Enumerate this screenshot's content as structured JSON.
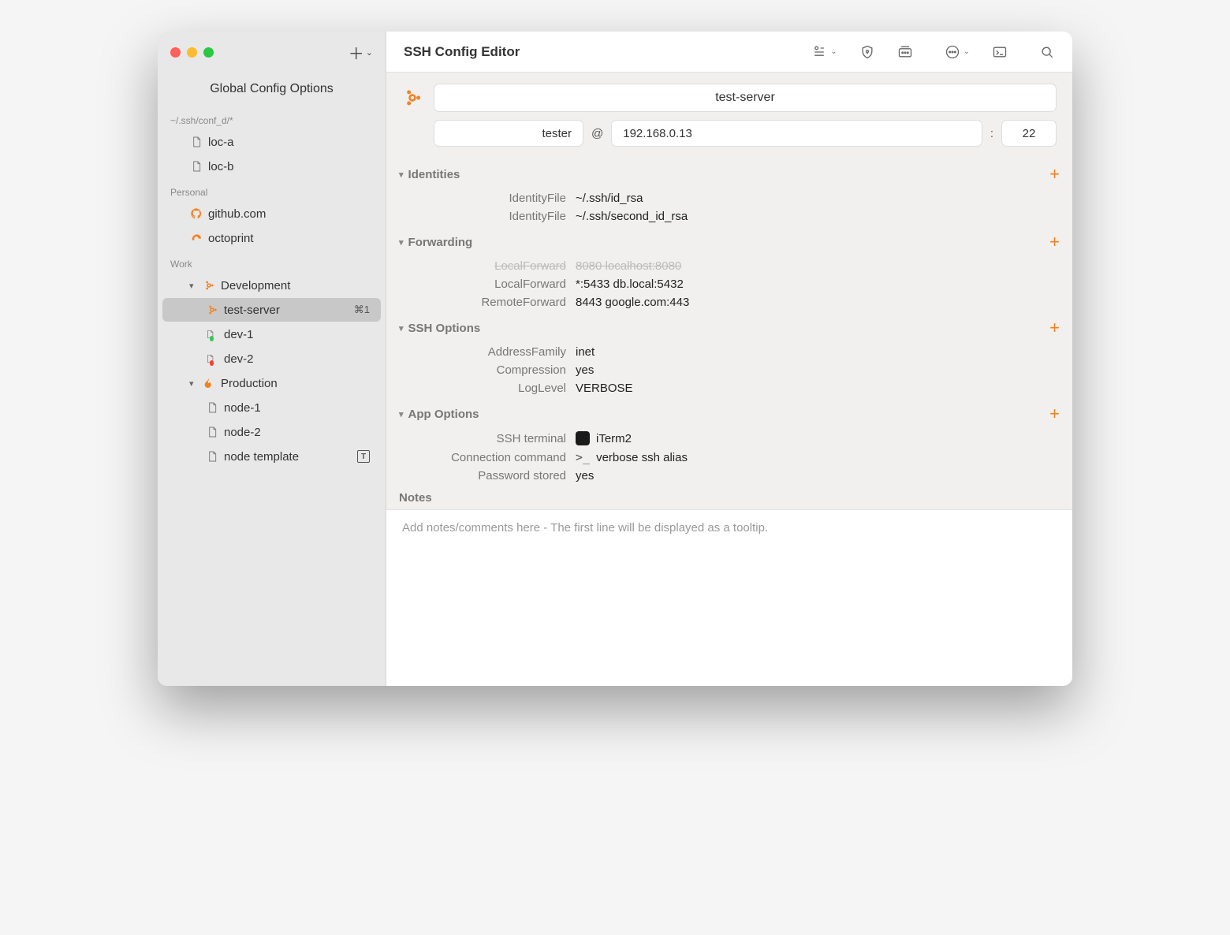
{
  "header": {
    "title": "SSH Config Editor"
  },
  "sidebar": {
    "global_label": "Global Config Options",
    "groups": [
      {
        "title": "~/.ssh/conf_d/*",
        "items": [
          {
            "label": "loc-a",
            "icon": "file"
          },
          {
            "label": "loc-b",
            "icon": "file"
          }
        ]
      },
      {
        "title": "Personal",
        "items": [
          {
            "label": "github.com",
            "icon": "github"
          },
          {
            "label": "octoprint",
            "icon": "octo"
          }
        ]
      },
      {
        "title": "Work",
        "items": [
          {
            "label": "Development",
            "icon": "folder-ubuntu",
            "expandable": true,
            "children": [
              {
                "label": "test-server",
                "icon": "ubuntu",
                "selected": true,
                "shortcut": "⌘1"
              },
              {
                "label": "dev-1",
                "icon": "file",
                "status": "green"
              },
              {
                "label": "dev-2",
                "icon": "file",
                "status": "red"
              }
            ]
          },
          {
            "label": "Production",
            "icon": "folder-fire",
            "expandable": true,
            "children": [
              {
                "label": "node-1",
                "icon": "file"
              },
              {
                "label": "node-2",
                "icon": "file"
              },
              {
                "label": "node template",
                "icon": "file",
                "template": true
              }
            ]
          }
        ]
      }
    ]
  },
  "detail": {
    "hostname": "test-server",
    "user": "tester",
    "ip": "192.168.0.13",
    "port": "22",
    "at": "@",
    "colon": ":",
    "sections": [
      {
        "title": "Identities",
        "add": true,
        "rows": [
          {
            "key": "IdentityFile",
            "val": "~/.ssh/id_rsa"
          },
          {
            "key": "IdentityFile",
            "val": "~/.ssh/second_id_rsa"
          }
        ]
      },
      {
        "title": "Forwarding",
        "add": true,
        "rows": [
          {
            "key": "LocalForward",
            "val": "8080 localhost:8080",
            "disabled": true
          },
          {
            "key": "LocalForward",
            "val": "*:5433 db.local:5432"
          },
          {
            "key": "RemoteForward",
            "val": "8443 google.com:443"
          }
        ]
      },
      {
        "title": "SSH Options",
        "add": true,
        "rows": [
          {
            "key": "AddressFamily",
            "val": "inet"
          },
          {
            "key": "Compression",
            "val": "yes"
          },
          {
            "key": "LogLevel",
            "val": "VERBOSE"
          }
        ]
      },
      {
        "title": "App Options",
        "add": true,
        "rows": [
          {
            "key": "SSH terminal",
            "val": "iTerm2",
            "appicon": true
          },
          {
            "key": "Connection command",
            "val": "verbose ssh alias",
            "prompt": true
          },
          {
            "key": "Password stored",
            "val": "yes"
          }
        ]
      }
    ],
    "notes_title": "Notes",
    "notes_placeholder": "Add notes/comments here - The first line will be displayed as a tooltip."
  }
}
